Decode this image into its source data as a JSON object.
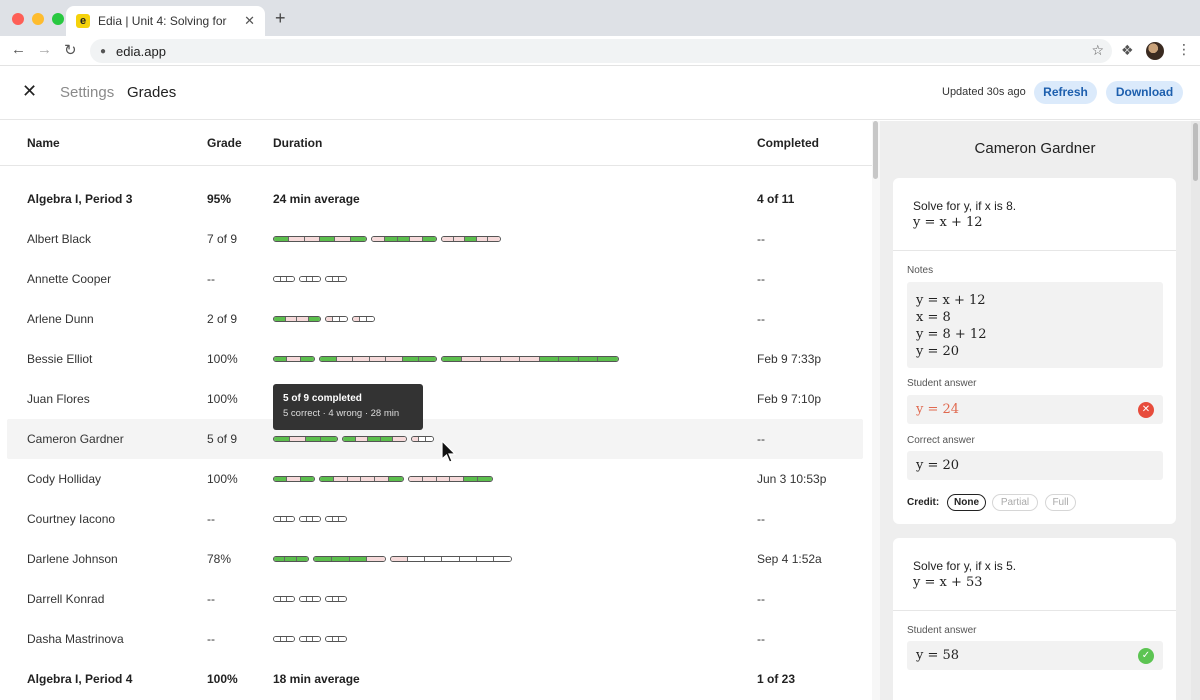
{
  "browser": {
    "tab_favicon": "e",
    "tab_title": "Edia |  Unit 4: Solving for",
    "tab_close": "✕",
    "new_tab": "+",
    "url": "edia.app"
  },
  "header": {
    "close": "✕",
    "settings": "Settings",
    "grades": "Grades",
    "updated": "Updated 30s ago",
    "refresh": "Refresh",
    "download": "Download"
  },
  "table": {
    "columns": {
      "name": "Name",
      "grade": "Grade",
      "duration": "Duration",
      "completed": "Completed"
    },
    "rows": [
      {
        "name": "Algebra I, Period 3",
        "grade": "95%",
        "duration": "24 min average",
        "completed": "4 of 11",
        "group": true
      },
      {
        "name": "Albert Black",
        "grade": "7 of 9",
        "completed": "--"
      },
      {
        "name": "Annette Cooper",
        "grade": "--",
        "completed": "--"
      },
      {
        "name": "Arlene Dunn",
        "grade": "2 of 9",
        "completed": "--"
      },
      {
        "name": "Bessie Elliot",
        "grade": "100%",
        "completed": "Feb 9 7:33p"
      },
      {
        "name": "Juan Flores",
        "grade": "100%",
        "completed": "Feb 9 7:10p"
      },
      {
        "name": "Cameron Gardner",
        "grade": "5 of 9",
        "completed": "--",
        "highlighted": true
      },
      {
        "name": "Cody Holliday",
        "grade": "100%",
        "completed": "Jun 3 10:53p"
      },
      {
        "name": "Courtney Iacono",
        "grade": "--",
        "completed": "--"
      },
      {
        "name": "Darlene Johnson",
        "grade": "78%",
        "completed": "Sep 4 1:52a"
      },
      {
        "name": "Darrell Konrad",
        "grade": "--",
        "completed": "--"
      },
      {
        "name": "Dasha Mastrinova",
        "grade": "--",
        "completed": "--"
      },
      {
        "name": "Algebra I, Period 4",
        "grade": "100%",
        "duration": "18 min average",
        "completed": "1 of 23",
        "group": true
      }
    ]
  },
  "tooltip": {
    "title": "5 of 9 completed",
    "subtitle": "5 correct · 4 wrong · 28 min"
  },
  "panel": {
    "student": "Cameron Gardner",
    "card1": {
      "question": "Solve for y, if x is 8.",
      "equation": "y = x + 12",
      "notes_label": "Notes",
      "notes": [
        "y = x + 12",
        "x = 8",
        "y = 8 + 12",
        "y = 20"
      ],
      "student_answer_label": "Student answer",
      "student_answer": "y = 24",
      "correct_answer_label": "Correct answer",
      "correct_answer": "y = 20",
      "credit_label": "Credit:",
      "credit_options": [
        "None",
        "Partial",
        "Full"
      ],
      "credit_selected": "None"
    },
    "card2": {
      "question": "Solve for y, if x is 5.",
      "equation": "y = x + 53",
      "student_answer_label": "Student answer",
      "student_answer": "y = 58"
    }
  },
  "colors": {
    "green": "#5cbf4d",
    "pink": "#f6dada",
    "accent": "#1d5fae",
    "wrong": "#e74c3c"
  }
}
